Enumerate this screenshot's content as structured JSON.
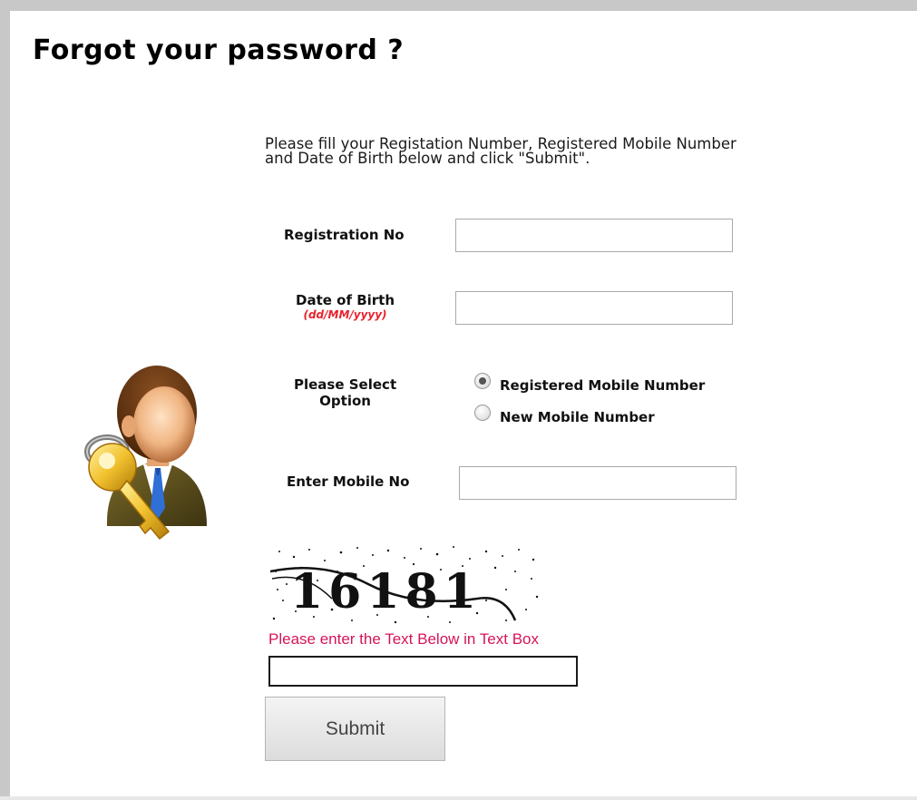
{
  "page": {
    "title": "Forgot your password ?",
    "instructions_line1": "Please fill your Registation Number, Registered Mobile Number",
    "instructions_line2": "and Date of Birth below and click \"Submit\"."
  },
  "form": {
    "registration_label": "Registration No",
    "registration_value": "",
    "dob_label": "Date of Birth",
    "dob_format": "(dd/MM/yyyy)",
    "dob_value": "",
    "option_label_line1": "Please Select",
    "option_label_line2": "Option",
    "options": [
      {
        "label": "Registered Mobile Number",
        "checked": true
      },
      {
        "label": "New Mobile Number",
        "checked": false
      }
    ],
    "mobile_label": "Enter Mobile No",
    "mobile_value": ""
  },
  "captcha": {
    "text": "16181",
    "hint": "Please enter the Text Below in Text Box",
    "input_value": ""
  },
  "submit_label": "Submit",
  "icons": {
    "avatar": "user-with-key-icon",
    "radio": "radio-button"
  },
  "colors": {
    "format_hint": "#e8242e",
    "captcha_hint": "#d4145a",
    "border": "#c8c8c8"
  }
}
